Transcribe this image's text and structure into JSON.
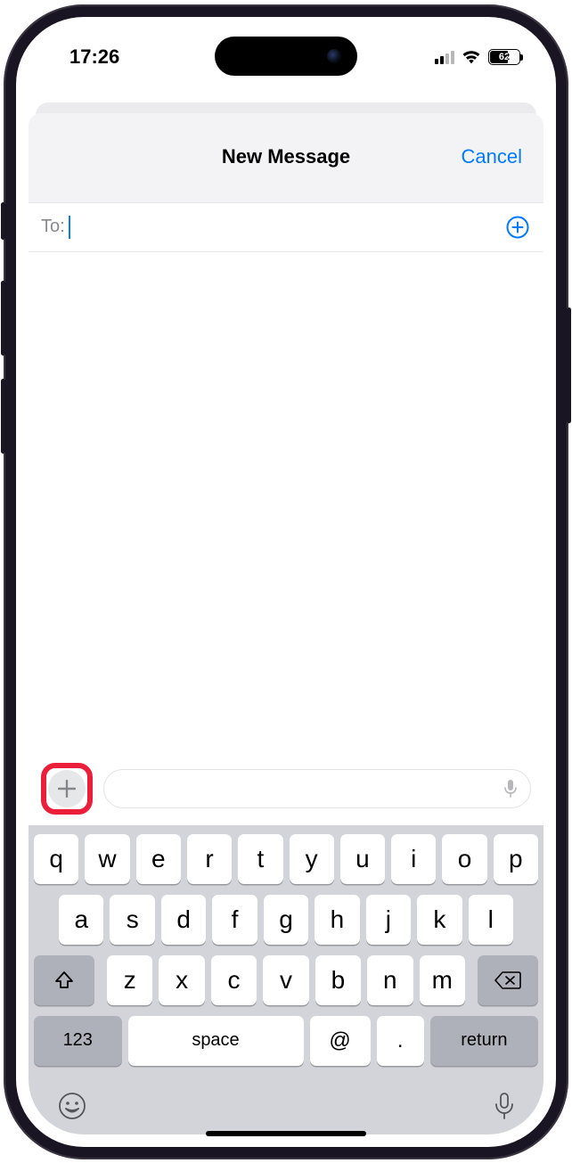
{
  "status": {
    "time": "17:26",
    "battery_pct": "62",
    "battery_fill_pct": 62
  },
  "header": {
    "title": "New Message",
    "cancel": "Cancel"
  },
  "recipients": {
    "label": "To:",
    "value": ""
  },
  "compose": {
    "placeholder": ""
  },
  "keyboard": {
    "row1": [
      "q",
      "w",
      "e",
      "r",
      "t",
      "y",
      "u",
      "i",
      "o",
      "p"
    ],
    "row2": [
      "a",
      "s",
      "d",
      "f",
      "g",
      "h",
      "j",
      "k",
      "l"
    ],
    "row3": [
      "z",
      "x",
      "c",
      "v",
      "b",
      "n",
      "m"
    ],
    "numbers": "123",
    "space": "space",
    "at": "@",
    "dot": ".",
    "return": "return"
  },
  "annotation": {
    "highlight": "plus-button"
  }
}
